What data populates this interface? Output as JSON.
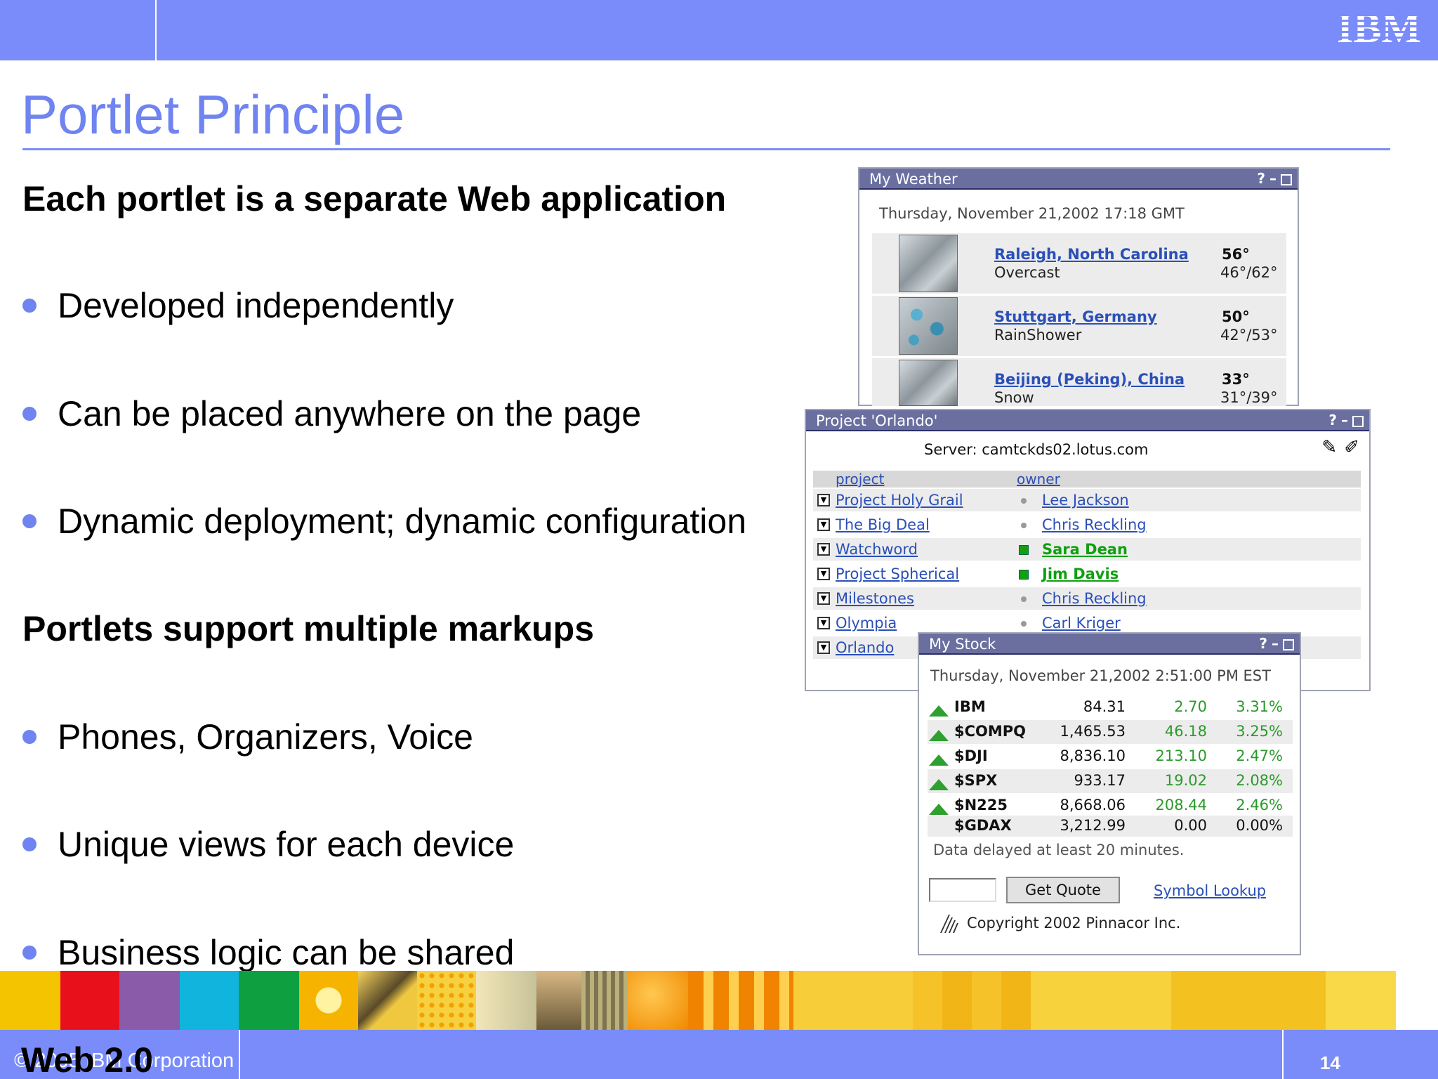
{
  "header": {
    "logo_text": "IBM"
  },
  "slide": {
    "title": "Portlet Principle",
    "heading1": "Each portlet is a separate Web application",
    "bullets1": [
      "Developed independently",
      "Can be placed anywhere on the page",
      "Dynamic deployment; dynamic configuration"
    ],
    "heading2": "Portlets support multiple markups",
    "bullets2": [
      "Phones, Organizers, Voice",
      "Unique views for each device",
      "Business logic can be shared"
    ]
  },
  "weather": {
    "title": "My Weather",
    "date": "Thursday, November 21,2002 17:18 GMT",
    "rows": [
      {
        "city": "Raleigh, North Carolina",
        "condition": "Overcast",
        "temp": "56°",
        "range": "46°/62°",
        "icon": "cloud-icon"
      },
      {
        "city": "Stuttgart, Germany",
        "condition": "RainShower",
        "temp": "50°",
        "range": "42°/53°",
        "icon": "rain-icon"
      },
      {
        "city": "Beijing (Peking), China",
        "condition": "Snow",
        "temp": "33°",
        "range": "31°/39°",
        "icon": "snow-icon"
      }
    ]
  },
  "orlando": {
    "title": "Project 'Orlando'",
    "server": "Server: camtckds02.lotus.com",
    "col_project": "project",
    "col_owner": "owner",
    "rows": [
      {
        "project": "Project Holy Grail",
        "owner": "Lee Jackson",
        "online": false
      },
      {
        "project": "The Big Deal",
        "owner": "Chris Reckling",
        "online": false
      },
      {
        "project": "Watchword",
        "owner": "Sara Dean",
        "online": true
      },
      {
        "project": "Project Spherical",
        "owner": "Jim Davis",
        "online": true
      },
      {
        "project": "Milestones",
        "owner": "Chris Reckling",
        "online": false
      },
      {
        "project": "Olympia",
        "owner": "Carl Kriger",
        "online": false
      },
      {
        "project": "Orlando",
        "owner": "",
        "online": false
      }
    ]
  },
  "stock": {
    "title": "My Stock",
    "date": "Thursday, November 21,2002 2:51:00 PM EST",
    "rows": [
      {
        "symbol": "IBM",
        "price": "84.31",
        "change": "2.70",
        "pct": "3.31%",
        "up": true
      },
      {
        "symbol": "$COMPQ",
        "price": "1,465.53",
        "change": "46.18",
        "pct": "3.25%",
        "up": true
      },
      {
        "symbol": "$DJI",
        "price": "8,836.10",
        "change": "213.10",
        "pct": "2.47%",
        "up": true
      },
      {
        "symbol": "$SPX",
        "price": "933.17",
        "change": "19.02",
        "pct": "2.08%",
        "up": true
      },
      {
        "symbol": "$N225",
        "price": "8,668.06",
        "change": "208.44",
        "pct": "2.46%",
        "up": true
      },
      {
        "symbol": "$GDAX",
        "price": "3,212.99",
        "change": "0.00",
        "pct": "0.00%",
        "up": false
      }
    ],
    "delay_note": "Data delayed at least 20 minutes.",
    "quote_value": "",
    "quote_button": "Get Quote",
    "symbol_lookup": "Symbol Lookup",
    "copyright": "Copyright 2002 Pinnacor Inc."
  },
  "footer": {
    "copyright": "© 2005 IBM Corporation",
    "overlay": "Web 2.0",
    "page_number": "14"
  },
  "colors": {
    "brand": "#7a8cfa",
    "title": "#6f84f0",
    "link": "#2a4fb8",
    "gain": "#2a9a2a"
  }
}
